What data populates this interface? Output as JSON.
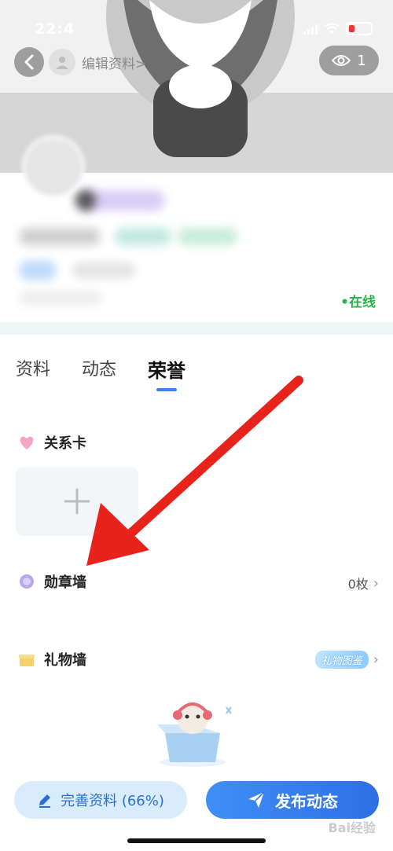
{
  "status_bar": {
    "time": "22:4"
  },
  "header": {
    "edit_profile_label": "编辑资料>",
    "views_count": "1"
  },
  "profile": {
    "online_status": "•在线"
  },
  "tabs": [
    {
      "label": "资料",
      "active": false
    },
    {
      "label": "动态",
      "active": false
    },
    {
      "label": "荣誉",
      "active": true
    }
  ],
  "sections": {
    "relation_card": {
      "title": "关系卡",
      "add_symbol": "+"
    },
    "badge_wall": {
      "title": "勋章墙",
      "count": "0枚"
    },
    "gift_wall": {
      "title": "礼物墙",
      "tag": "礼物图鉴"
    }
  },
  "bottom_bar": {
    "complete_label": "完善资料 (66%)",
    "publish_label": "发布动态"
  },
  "watermark": "Bai经验",
  "colors": {
    "accent": "#3b82f6",
    "online": "#2bb24c",
    "publish_bg": "#2d6fe6",
    "complete_bg": "#d9ecfb",
    "arrow": "#e8231b"
  }
}
